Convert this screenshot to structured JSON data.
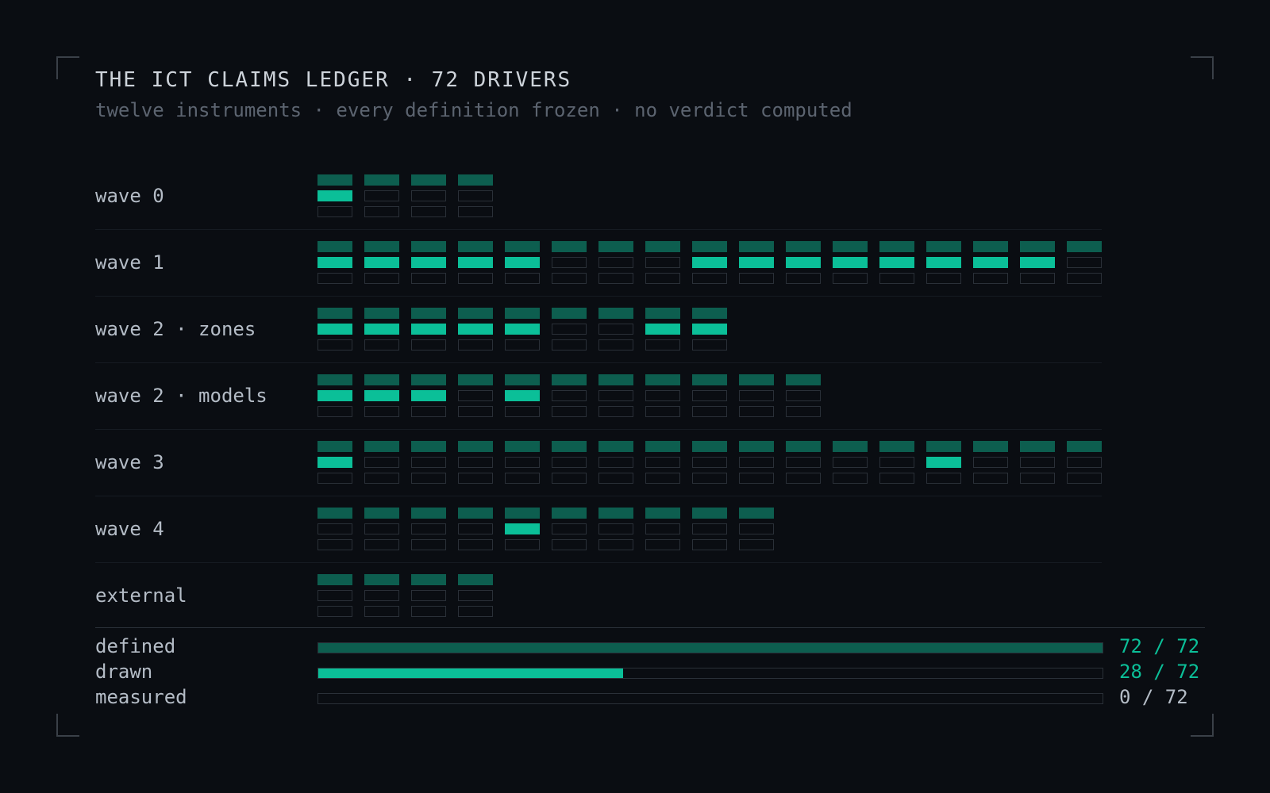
{
  "header": {
    "title": "THE ICT CLAIMS LEDGER · 72 DRIVERS",
    "subtitle": "twelve instruments · every definition frozen · no verdict computed"
  },
  "colors": {
    "background": "#0a0d12",
    "defined": "#0d5e4f",
    "drawn": "#0bbf98",
    "empty_border": "#2a3038",
    "label": "#b4bcc6",
    "muted": "#5c6470"
  },
  "chart_data": {
    "type": "table",
    "stages": [
      "defined",
      "drawn",
      "measured"
    ],
    "waves": [
      {
        "label": "wave 0",
        "count": 4,
        "drawn": [
          1,
          0,
          0,
          0
        ],
        "measured": [
          0,
          0,
          0,
          0
        ]
      },
      {
        "label": "wave 1",
        "count": 17,
        "drawn": [
          1,
          1,
          1,
          1,
          1,
          0,
          0,
          0,
          1,
          1,
          1,
          1,
          1,
          1,
          1,
          1,
          0
        ],
        "measured": [
          0,
          0,
          0,
          0,
          0,
          0,
          0,
          0,
          0,
          0,
          0,
          0,
          0,
          0,
          0,
          0,
          0
        ]
      },
      {
        "label": "wave 2 · zones",
        "count": 9,
        "drawn": [
          1,
          1,
          1,
          1,
          1,
          0,
          0,
          1,
          1
        ],
        "measured": [
          0,
          0,
          0,
          0,
          0,
          0,
          0,
          0,
          0
        ]
      },
      {
        "label": "wave 2 · models",
        "count": 11,
        "drawn": [
          1,
          1,
          1,
          0,
          1,
          0,
          0,
          0,
          0,
          0,
          0
        ],
        "measured": [
          0,
          0,
          0,
          0,
          0,
          0,
          0,
          0,
          0,
          0,
          0
        ]
      },
      {
        "label": "wave 3",
        "count": 17,
        "drawn": [
          1,
          0,
          0,
          0,
          0,
          0,
          0,
          0,
          0,
          0,
          0,
          0,
          0,
          1,
          0,
          0,
          0
        ],
        "measured": [
          0,
          0,
          0,
          0,
          0,
          0,
          0,
          0,
          0,
          0,
          0,
          0,
          0,
          0,
          0,
          0,
          0
        ]
      },
      {
        "label": "wave 4",
        "count": 10,
        "drawn": [
          0,
          0,
          0,
          0,
          1,
          0,
          0,
          0,
          0,
          0
        ],
        "measured": [
          0,
          0,
          0,
          0,
          0,
          0,
          0,
          0,
          0,
          0
        ]
      },
      {
        "label": "external",
        "count": 4,
        "drawn": [
          0,
          0,
          0,
          0
        ],
        "measured": [
          0,
          0,
          0,
          0
        ]
      }
    ],
    "progress": [
      {
        "label": "defined",
        "value": 72,
        "total": 72,
        "value_text": "72 / 72"
      },
      {
        "label": "drawn",
        "value": 28,
        "total": 72,
        "value_text": "28 / 72"
      },
      {
        "label": "measured",
        "value": 0,
        "total": 72,
        "value_text": "0 / 72"
      }
    ]
  }
}
